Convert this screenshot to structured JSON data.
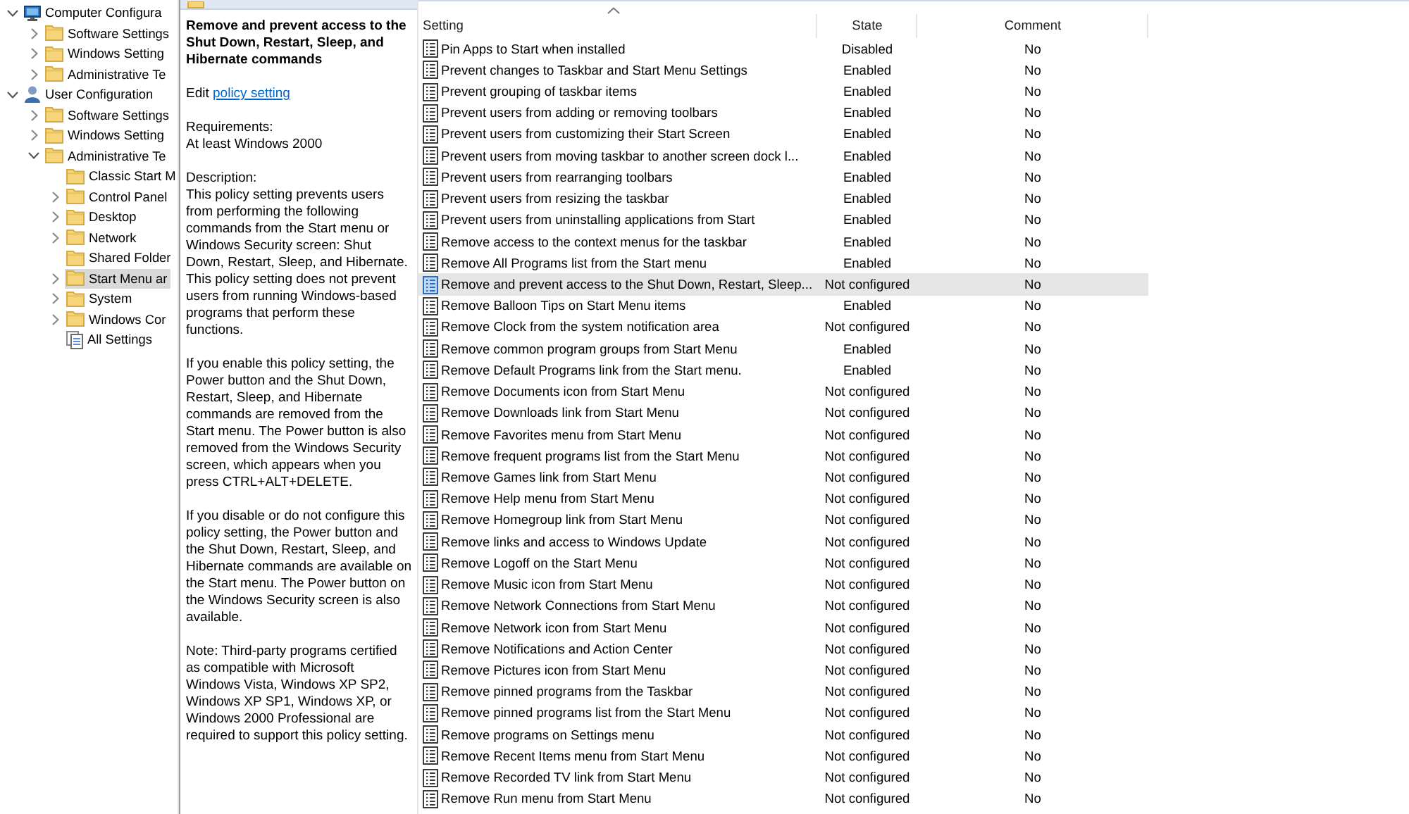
{
  "tree": {
    "items": [
      {
        "label": "Computer Configura",
        "kind": "computer",
        "expandable": true,
        "expanded": true,
        "selected": false,
        "children": [
          {
            "label": "Software Settings",
            "kind": "folder",
            "expandable": true,
            "expanded": false,
            "selected": false
          },
          {
            "label": "Windows Setting",
            "kind": "folder",
            "expandable": true,
            "expanded": false,
            "selected": false
          },
          {
            "label": "Administrative Te",
            "kind": "folder",
            "expandable": true,
            "expanded": false,
            "selected": false
          }
        ]
      },
      {
        "label": "User Configuration",
        "kind": "user",
        "expandable": true,
        "expanded": true,
        "selected": false,
        "children": [
          {
            "label": "Software Settings",
            "kind": "folder",
            "expandable": true,
            "expanded": false,
            "selected": false
          },
          {
            "label": "Windows Setting",
            "kind": "folder",
            "expandable": true,
            "expanded": false,
            "selected": false
          },
          {
            "label": "Administrative Te",
            "kind": "folder",
            "expandable": true,
            "expanded": true,
            "selected": false,
            "children": [
              {
                "label": "Classic Start M",
                "kind": "folder",
                "expandable": false,
                "expanded": false,
                "selected": false
              },
              {
                "label": "Control Panel",
                "kind": "folder",
                "expandable": true,
                "expanded": false,
                "selected": false
              },
              {
                "label": "Desktop",
                "kind": "folder",
                "expandable": true,
                "expanded": false,
                "selected": false
              },
              {
                "label": "Network",
                "kind": "folder",
                "expandable": true,
                "expanded": false,
                "selected": false
              },
              {
                "label": "Shared Folder",
                "kind": "folder",
                "expandable": false,
                "expanded": false,
                "selected": false
              },
              {
                "label": "Start Menu ar",
                "kind": "folder",
                "expandable": true,
                "expanded": false,
                "selected": true
              },
              {
                "label": "System",
                "kind": "folder",
                "expandable": true,
                "expanded": false,
                "selected": false
              },
              {
                "label": "Windows Cor",
                "kind": "folder",
                "expandable": true,
                "expanded": false,
                "selected": false
              },
              {
                "label": "All Settings",
                "kind": "pages",
                "expandable": false,
                "expanded": false,
                "selected": false
              }
            ]
          }
        ]
      }
    ]
  },
  "details": {
    "title": "Remove and prevent access to the Shut Down, Restart, Sleep, and Hibernate commands",
    "edit_label": "Edit",
    "edit_link": "policy setting",
    "requirements_label": "Requirements:",
    "requirements": "At least Windows 2000",
    "description_label": "Description:",
    "paragraphs": [
      "This policy setting prevents users from performing the following commands from the Start menu or Windows Security screen: Shut Down, Restart, Sleep, and Hibernate. This policy setting does not prevent users from running Windows-based programs that perform these functions.",
      "If you enable this policy setting, the Power button and the Shut Down, Restart, Sleep, and Hibernate commands are removed from the Start menu. The Power button is also removed from the Windows Security screen, which appears when you press CTRL+ALT+DELETE.",
      "If you disable or do not configure this policy setting, the Power button and the Shut Down, Restart, Sleep, and Hibernate commands are available on the Start menu. The Power button on the Windows Security screen is also available.",
      "Note: Third-party programs certified as compatible with Microsoft Windows Vista, Windows XP SP2, Windows XP SP1, Windows XP, or Windows 2000 Professional are required to support this policy setting."
    ]
  },
  "table": {
    "columns": [
      {
        "label": "Setting",
        "sorted": true
      },
      {
        "label": "State",
        "sorted": false
      },
      {
        "label": "Comment",
        "sorted": false
      }
    ],
    "rows": [
      {
        "setting": "Pin Apps to Start when installed",
        "state": "Disabled",
        "comment": "No",
        "selected": false
      },
      {
        "setting": "Prevent changes to Taskbar and Start Menu Settings",
        "state": "Enabled",
        "comment": "No",
        "selected": false
      },
      {
        "setting": "Prevent grouping of taskbar items",
        "state": "Enabled",
        "comment": "No",
        "selected": false
      },
      {
        "setting": "Prevent users from adding or removing toolbars",
        "state": "Enabled",
        "comment": "No",
        "selected": false
      },
      {
        "setting": "Prevent users from customizing their Start Screen",
        "state": "Enabled",
        "comment": "No",
        "selected": false
      },
      {
        "setting": "Prevent users from moving taskbar to another screen dock l...",
        "state": "Enabled",
        "comment": "No",
        "selected": false
      },
      {
        "setting": "Prevent users from rearranging toolbars",
        "state": "Enabled",
        "comment": "No",
        "selected": false
      },
      {
        "setting": "Prevent users from resizing the taskbar",
        "state": "Enabled",
        "comment": "No",
        "selected": false
      },
      {
        "setting": "Prevent users from uninstalling applications from Start",
        "state": "Enabled",
        "comment": "No",
        "selected": false
      },
      {
        "setting": "Remove access to the context menus for the taskbar",
        "state": "Enabled",
        "comment": "No",
        "selected": false
      },
      {
        "setting": "Remove All Programs list from the Start menu",
        "state": "Enabled",
        "comment": "No",
        "selected": false
      },
      {
        "setting": "Remove and prevent access to the Shut Down, Restart, Sleep...",
        "state": "Not configured",
        "comment": "No",
        "selected": true
      },
      {
        "setting": "Remove Balloon Tips on Start Menu items",
        "state": "Enabled",
        "comment": "No",
        "selected": false
      },
      {
        "setting": "Remove Clock from the system notification area",
        "state": "Not configured",
        "comment": "No",
        "selected": false
      },
      {
        "setting": "Remove common program groups from Start Menu",
        "state": "Enabled",
        "comment": "No",
        "selected": false
      },
      {
        "setting": "Remove Default Programs link from the Start menu.",
        "state": "Enabled",
        "comment": "No",
        "selected": false
      },
      {
        "setting": "Remove Documents icon from Start Menu",
        "state": "Not configured",
        "comment": "No",
        "selected": false
      },
      {
        "setting": "Remove Downloads link from Start Menu",
        "state": "Not configured",
        "comment": "No",
        "selected": false
      },
      {
        "setting": "Remove Favorites menu from Start Menu",
        "state": "Not configured",
        "comment": "No",
        "selected": false
      },
      {
        "setting": "Remove frequent programs list from the Start Menu",
        "state": "Not configured",
        "comment": "No",
        "selected": false
      },
      {
        "setting": "Remove Games link from Start Menu",
        "state": "Not configured",
        "comment": "No",
        "selected": false
      },
      {
        "setting": "Remove Help menu from Start Menu",
        "state": "Not configured",
        "comment": "No",
        "selected": false
      },
      {
        "setting": "Remove Homegroup link from Start Menu",
        "state": "Not configured",
        "comment": "No",
        "selected": false
      },
      {
        "setting": "Remove links and access to Windows Update",
        "state": "Not configured",
        "comment": "No",
        "selected": false
      },
      {
        "setting": "Remove Logoff on the Start Menu",
        "state": "Not configured",
        "comment": "No",
        "selected": false
      },
      {
        "setting": "Remove Music icon from Start Menu",
        "state": "Not configured",
        "comment": "No",
        "selected": false
      },
      {
        "setting": "Remove Network Connections from Start Menu",
        "state": "Not configured",
        "comment": "No",
        "selected": false
      },
      {
        "setting": "Remove Network icon from Start Menu",
        "state": "Not configured",
        "comment": "No",
        "selected": false
      },
      {
        "setting": "Remove Notifications and Action Center",
        "state": "Not configured",
        "comment": "No",
        "selected": false
      },
      {
        "setting": "Remove Pictures icon from Start Menu",
        "state": "Not configured",
        "comment": "No",
        "selected": false
      },
      {
        "setting": "Remove pinned programs from the Taskbar",
        "state": "Not configured",
        "comment": "No",
        "selected": false
      },
      {
        "setting": "Remove pinned programs list from the Start Menu",
        "state": "Not configured",
        "comment": "No",
        "selected": false
      },
      {
        "setting": "Remove programs on Settings menu",
        "state": "Not configured",
        "comment": "No",
        "selected": false
      },
      {
        "setting": "Remove Recent Items menu from Start Menu",
        "state": "Not configured",
        "comment": "No",
        "selected": false
      },
      {
        "setting": "Remove Recorded TV link from Start Menu",
        "state": "Not configured",
        "comment": "No",
        "selected": false
      },
      {
        "setting": "Remove Run menu from Start Menu",
        "state": "Not configured",
        "comment": "No",
        "selected": false
      }
    ]
  }
}
